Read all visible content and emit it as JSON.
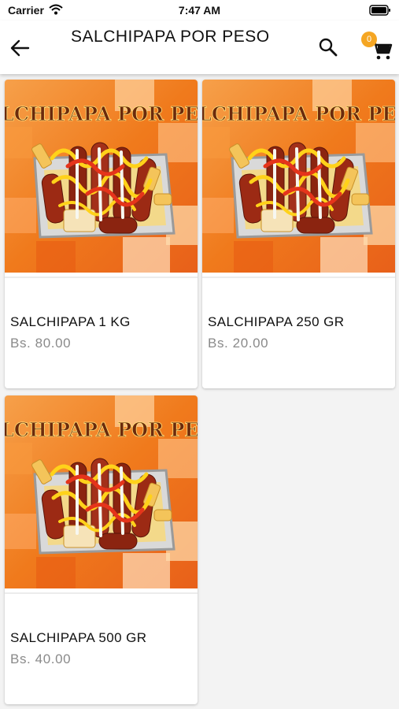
{
  "status_bar": {
    "carrier": "Carrier",
    "time": "7:47 AM"
  },
  "app_bar": {
    "title": "SALCHIPAPA POR PESO",
    "back_icon": "arrow-left-icon",
    "search_icon": "search-icon",
    "cart_icon": "cart-icon",
    "cart_count": "0"
  },
  "image_banner_text": "SALCHIPAPA POR PESO",
  "products": [
    {
      "name": "SALCHIPAPA 1 KG",
      "price": "Bs. 80.00"
    },
    {
      "name": "SALCHIPAPA 250 GR",
      "price": "Bs. 20.00"
    },
    {
      "name": "SALCHIPAPA 500 GR",
      "price": "Bs. 40.00"
    }
  ],
  "colors": {
    "accent": "#f5a623",
    "price": "#8a8a8a",
    "image_bg": "#f07a1c"
  }
}
